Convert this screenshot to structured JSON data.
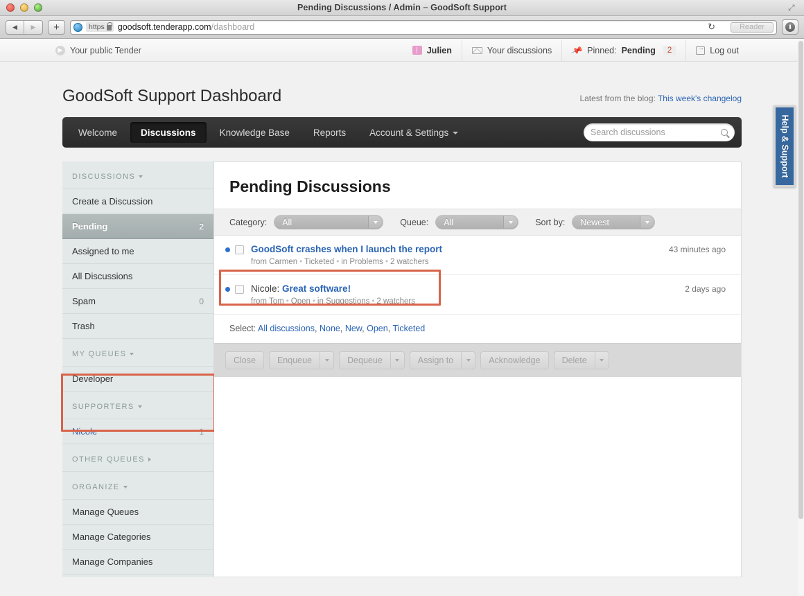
{
  "browser": {
    "window_title": "Pending Discussions / Admin – GoodSoft Support",
    "back_icon": "back-arrow-icon",
    "forward_icon": "forward-arrow-icon",
    "new_tab_label": "+",
    "scheme_label": "https",
    "url_host": "goodsoft.tenderapp.com",
    "url_path": "/dashboard",
    "reload_label": "↻",
    "reader_label": "Reader",
    "download_label": "⬇"
  },
  "utilbar": {
    "public_tender_label": "Your public Tender",
    "user_name": "Julien",
    "your_discussions_label": "Your discussions",
    "pinned_prefix": "Pinned:",
    "pinned_value": "Pending",
    "pinned_count": "2",
    "logout_label": "Log out"
  },
  "header": {
    "dashboard_title": "GoodSoft Support Dashboard",
    "blog_prefix": "Latest from the blog:",
    "blog_link": "This week's changelog"
  },
  "nav": {
    "tabs": [
      {
        "label": "Welcome",
        "active": false,
        "has_caret": false
      },
      {
        "label": "Discussions",
        "active": true,
        "has_caret": false
      },
      {
        "label": "Knowledge Base",
        "active": false,
        "has_caret": false
      },
      {
        "label": "Reports",
        "active": false,
        "has_caret": false
      },
      {
        "label": "Account & Settings",
        "active": false,
        "has_caret": true
      }
    ],
    "search_placeholder": "Search discussions",
    "search_value": ""
  },
  "sidebar": {
    "section_discussions": "DISCUSSIONS",
    "section_my_queues": "MY QUEUES",
    "section_supporters": "SUPPORTERS",
    "section_other_queues": "OTHER QUEUES",
    "section_organize": "ORGANIZE",
    "items": [
      {
        "label": "Create a Discussion",
        "count": ""
      },
      {
        "label": "Pending",
        "count": "2"
      },
      {
        "label": "Assigned to me",
        "count": ""
      },
      {
        "label": "All Discussions",
        "count": ""
      },
      {
        "label": "Spam",
        "count": "0"
      },
      {
        "label": "Trash",
        "count": ""
      }
    ],
    "my_queues": [
      {
        "label": "Developer",
        "count": ""
      }
    ],
    "supporters": [
      {
        "label": "Nicole",
        "count": "1"
      }
    ],
    "organize": [
      {
        "label": "Manage Queues",
        "count": ""
      },
      {
        "label": "Manage Categories",
        "count": ""
      },
      {
        "label": "Manage Companies",
        "count": ""
      }
    ]
  },
  "content": {
    "title": "Pending Discussions",
    "filters": [
      {
        "name": "Category:",
        "value": "All"
      },
      {
        "name": "Queue:",
        "value": "All"
      },
      {
        "name": "Sort by:",
        "value": "Newest"
      }
    ],
    "discussions": [
      {
        "prefix": "",
        "title": "GoodSoft crashes when I launch the report",
        "from": "from Carmen",
        "status": "Ticketed",
        "category": "in Problems",
        "watchers": "2 watchers",
        "time": "43 minutes ago"
      },
      {
        "prefix": "Nicole:",
        "title": "Great software!",
        "from": "from Tom",
        "status": "Open",
        "category": "in Suggestions",
        "watchers": "2 watchers",
        "time": "2 days ago"
      }
    ],
    "select_label": "Select:",
    "select_links": [
      "All discussions",
      "None",
      "New",
      "Open",
      "Ticketed"
    ],
    "actions": [
      {
        "label": "Close",
        "has_arrow": false
      },
      {
        "label": "Enqueue",
        "has_arrow": true
      },
      {
        "label": "Dequeue",
        "has_arrow": true
      },
      {
        "label": "Assign to",
        "has_arrow": true
      },
      {
        "label": "Acknowledge",
        "has_arrow": false
      },
      {
        "label": "Delete",
        "has_arrow": true
      }
    ]
  },
  "help_tab": {
    "label": "Help & Support"
  },
  "highlight_color": "#d9644a"
}
